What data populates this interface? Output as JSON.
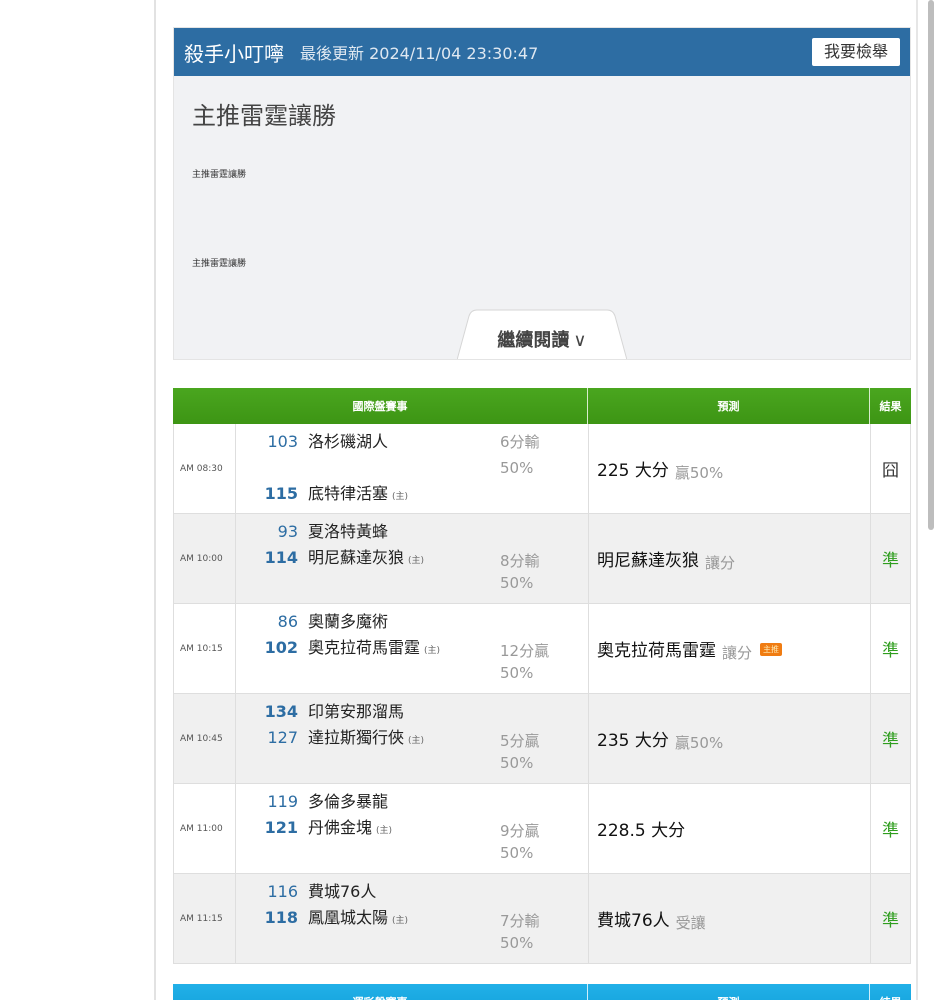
{
  "post": {
    "author": "殺手小叮嚀",
    "updated": "最後更新 2024/11/04 23:30:47",
    "report_label": "我要檢舉",
    "title": "主推雷霆讓勝",
    "line1": "主推雷霆讓勝",
    "line2": "主推雷霆讓勝",
    "read_more": "繼續閱讀"
  },
  "table": {
    "headers": {
      "match": "國際盤賽事",
      "prediction": "預測",
      "result": "結果"
    },
    "home_mark": "(主)",
    "rows": [
      {
        "time": "AM 08:30",
        "team1": {
          "num": "103",
          "name": "洛杉磯湖人",
          "home": ""
        },
        "team2": {
          "num": "115",
          "name": "底特律活塞",
          "home": "(主)"
        },
        "line": "6分輸",
        "pct": "50%",
        "pred": "225 大分",
        "pred_note": "贏50%",
        "badge": "",
        "result": "囧",
        "result_type": "push"
      },
      {
        "time": "AM 10:00",
        "team1": {
          "num": "93",
          "name": "夏洛特黃蜂",
          "home": ""
        },
        "team2": {
          "num": "114",
          "name": "明尼蘇達灰狼",
          "home": "(主)"
        },
        "line": "8分輸",
        "pct": "50%",
        "pred": "明尼蘇達灰狼",
        "pred_note": "讓分",
        "badge": "",
        "result": "準",
        "result_type": "hit"
      },
      {
        "time": "AM 10:15",
        "team1": {
          "num": "86",
          "name": "奧蘭多魔術",
          "home": ""
        },
        "team2": {
          "num": "102",
          "name": "奧克拉荷馬雷霆",
          "home": "(主)"
        },
        "line": "12分贏",
        "pct": "50%",
        "pred": "奧克拉荷馬雷霆",
        "pred_note": "讓分",
        "badge": "主推",
        "result": "準",
        "result_type": "hit"
      },
      {
        "time": "AM 10:45",
        "team1": {
          "num": "134",
          "name": "印第安那溜馬",
          "home": ""
        },
        "team2": {
          "num": "127",
          "name": "達拉斯獨行俠",
          "home": "(主)"
        },
        "line": "5分贏",
        "pct": "50%",
        "pred": "235 大分",
        "pred_note": "贏50%",
        "badge": "",
        "result": "準",
        "result_type": "hit"
      },
      {
        "time": "AM 11:00",
        "team1": {
          "num": "119",
          "name": "多倫多暴龍",
          "home": ""
        },
        "team2": {
          "num": "121",
          "name": "丹佛金塊",
          "home": "(主)"
        },
        "line": "9分贏",
        "pct": "50%",
        "pred": "228.5 大分",
        "pred_note": "",
        "badge": "",
        "result": "準",
        "result_type": "hit"
      },
      {
        "time": "AM 11:15",
        "team1": {
          "num": "116",
          "name": "費城76人",
          "home": ""
        },
        "team2": {
          "num": "118",
          "name": "鳳凰城太陽",
          "home": "(主)"
        },
        "line": "7分輸",
        "pct": "50%",
        "pred": "費城76人",
        "pred_note": "受讓",
        "badge": "",
        "result": "準",
        "result_type": "hit"
      }
    ]
  },
  "table2": {
    "headers": {
      "match": "運彩盤賽事",
      "prediction": "預測",
      "result": "結果"
    }
  },
  "colors": {
    "post_header": "#2d6da3",
    "intl_header": "#4aa61f",
    "sports_header": "#1aa9e2",
    "hit": "#2f9e1f",
    "badge": "#f07c12"
  }
}
